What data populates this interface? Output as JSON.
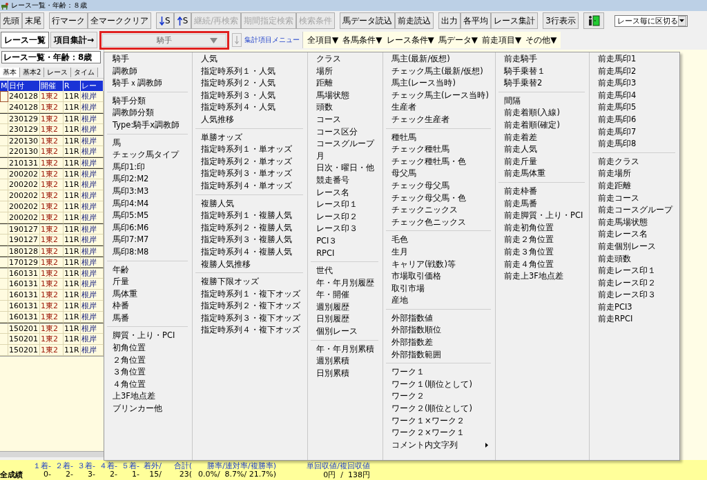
{
  "window": {
    "title": "レース一覧・年齢：８歳"
  },
  "toolbar": [
    [
      {
        "label": "先頭",
        "kind": "text",
        "disabled": false
      },
      {
        "label": "末尾",
        "kind": "text",
        "disabled": false
      }
    ],
    [
      {
        "label": "行マーク",
        "kind": "text",
        "disabled": false
      },
      {
        "label": "全マーククリア",
        "kind": "text",
        "disabled": false
      }
    ],
    [
      {
        "label": "S",
        "kind": "sort-down",
        "disabled": false
      },
      {
        "label": "S",
        "kind": "sort-up",
        "disabled": false
      },
      {
        "label": "継続/再検索",
        "kind": "text",
        "disabled": true
      },
      {
        "label": "期間指定検索",
        "kind": "text",
        "disabled": true
      },
      {
        "label": "検索条件",
        "kind": "text",
        "disabled": true
      }
    ],
    [
      {
        "label": "馬データ読込",
        "kind": "text",
        "disabled": false
      },
      {
        "label": "前走読込",
        "kind": "text",
        "disabled": false
      }
    ],
    [
      {
        "label": "出力",
        "kind": "text",
        "disabled": false
      },
      {
        "label": "各平均",
        "kind": "text",
        "disabled": false
      },
      {
        "label": "レース集計",
        "kind": "text",
        "disabled": false
      }
    ],
    [
      {
        "label": "3行表示",
        "kind": "text",
        "disabled": false
      }
    ],
    [
      {
        "kind": "exit-icon",
        "disabled": false
      }
    ]
  ],
  "split_select": {
    "value": "レース毎に区切る"
  },
  "mode_tabs": [
    {
      "label": "レース一覧",
      "selected": true
    },
    {
      "label": "項目集計→",
      "selected": false
    }
  ],
  "aggregate_select": {
    "value": "騎手",
    "highlighted": true
  },
  "aggregate_menu_link": "集計項目メニュー",
  "category_menus": [
    "全項目▼",
    "各馬条件▼",
    "レース条件▼",
    "馬データ▼",
    "前走項目▼",
    "その他▼"
  ],
  "panel_title": "レース一覧・年齢：8歳",
  "list_tabs": [
    {
      "label": "基本",
      "selected": true
    },
    {
      "label": "基本2",
      "selected": false
    },
    {
      "label": "レース",
      "selected": false
    },
    {
      "label": "タイム",
      "selected": false
    }
  ],
  "table": {
    "columns": [
      "M",
      "日付",
      "開催",
      "R",
      "レー"
    ],
    "rows": [
      [
        "",
        "240128",
        "1東2",
        "11R",
        "根岸"
      ],
      [
        "",
        "240128",
        "1東2",
        "11R",
        "根岸"
      ],
      [
        "",
        "230129",
        "1東2",
        "11R",
        "根岸"
      ],
      [
        "",
        "230129",
        "1東2",
        "11R",
        "根岸"
      ],
      [
        "",
        "220130",
        "1東2",
        "11R",
        "根岸"
      ],
      [
        "",
        "220130",
        "1東2",
        "11R",
        "根岸"
      ],
      [
        "",
        "210131",
        "1東2",
        "11R",
        "根岸"
      ],
      [
        "",
        "200202",
        "1東2",
        "11R",
        "根岸"
      ],
      [
        "",
        "200202",
        "1東2",
        "11R",
        "根岸"
      ],
      [
        "",
        "200202",
        "1東2",
        "11R",
        "根岸"
      ],
      [
        "",
        "200202",
        "1東2",
        "11R",
        "根岸"
      ],
      [
        "",
        "200202",
        "1東2",
        "11R",
        "根岸"
      ],
      [
        "",
        "190127",
        "1東2",
        "11R",
        "根岸"
      ],
      [
        "",
        "190127",
        "1東2",
        "11R",
        "根岸"
      ],
      [
        "",
        "180128",
        "1東2",
        "11R",
        "根岸"
      ],
      [
        "",
        "170129",
        "1東2",
        "11R",
        "根岸"
      ],
      [
        "",
        "160131",
        "1東2",
        "11R",
        "根岸"
      ],
      [
        "",
        "160131",
        "1東2",
        "11R",
        "根岸"
      ],
      [
        "",
        "160131",
        "1東2",
        "11R",
        "根岸"
      ],
      [
        "",
        "160131",
        "1東2",
        "11R",
        "根岸"
      ],
      [
        "",
        "160131",
        "1東2",
        "11R",
        "根岸"
      ],
      [
        "",
        "150201",
        "1東2",
        "11R",
        "根岸"
      ],
      [
        "",
        "150201",
        "1東2",
        "11R",
        "根岸"
      ],
      [
        "",
        "150201",
        "1東2",
        "11R",
        "根岸"
      ]
    ]
  },
  "dropdown_menu": {
    "columns": [
      [
        [
          "騎手",
          "調教師",
          "騎手ｘ調教師"
        ],
        [
          "騎手分類",
          "調教師分類",
          "Type:騎手x調教師"
        ],
        [
          "馬",
          "チェック馬タイプ",
          "馬印1:印",
          "馬印2:M2",
          "馬印3:M3",
          "馬印4:M4",
          "馬印5:M5",
          "馬印6:M6",
          "馬印7:M7",
          "馬印8:M8"
        ],
        [
          "年齢",
          "斤量",
          "馬体重",
          "枠番",
          "馬番"
        ],
        [
          "脚質・上り・PCI",
          "初角位置",
          "２角位置",
          "３角位置",
          "４角位置",
          "上3F地点差",
          "ブリンカー他"
        ]
      ],
      [
        [
          "人気",
          "指定時系列１・人気",
          "指定時系列２・人気",
          "指定時系列３・人気",
          "指定時系列４・人気",
          "人気推移"
        ],
        [
          "単勝オッズ",
          "指定時系列１・単オッズ",
          "指定時系列２・単オッズ",
          "指定時系列３・単オッズ",
          "指定時系列４・単オッズ"
        ],
        [
          "複勝人気",
          "指定時系列１・複勝人気",
          "指定時系列２・複勝人気",
          "指定時系列３・複勝人気",
          "指定時系列４・複勝人気",
          "複勝人気推移"
        ],
        [
          "複勝下限オッズ",
          "指定時系列１・複下オッズ",
          "指定時系列２・複下オッズ",
          "指定時系列３・複下オッズ",
          "指定時系列４・複下オッズ"
        ]
      ],
      [
        [
          "クラス",
          "場所",
          "距離",
          "馬場状態",
          "頭数",
          "コース",
          "コース区分",
          "コースグループ",
          "月",
          "日次・曜日・他",
          "競走番号",
          "レース名",
          "レース印１",
          "レース印２",
          "レース印３",
          "PCI３",
          "RPCI"
        ],
        [
          "世代",
          "年・年月別履歴",
          "年・開催",
          "週別履歴",
          "日別履歴",
          "個別レース"
        ],
        [
          "年・年月別累積",
          "週別累積",
          "日別累積"
        ]
      ],
      [
        [
          "馬主(最新/仮想)",
          "チェック馬主(最新/仮想)",
          "馬主(レース当時)",
          "チェック馬主(レース当時)",
          "生産者",
          "チェック生産者"
        ],
        [
          "種牡馬",
          "チェック種牡馬",
          "チェック種牡馬・色",
          "母父馬",
          "チェック母父馬",
          "チェック母父馬・色",
          "チェックニックス",
          "チェック色ニックス"
        ],
        [
          "毛色",
          "生月",
          "キャリア(戦数)等",
          "市場取引価格",
          "取引市場",
          "産地"
        ],
        [
          "外部指数値",
          "外部指数順位",
          "外部指数差",
          "外部指数範囲"
        ],
        [
          "ワーク１",
          "ワーク１(順位として)",
          "ワーク２",
          "ワーク２(順位として)",
          "ワーク１×ワーク２",
          "ワーク２×ワーク１",
          {
            "label": "コメント内文字列",
            "kind": "submenu"
          }
        ]
      ],
      [
        [
          "前走騎手",
          "騎手乗替１",
          "騎手乗替2"
        ],
        [
          "間隔",
          "前走着順(入線)",
          "前走着順(確定)",
          "前走着差",
          "前走人気",
          "前走斤量",
          "前走馬体重"
        ],
        [
          "前走枠番",
          "前走馬番",
          "前走脚質・上り・PCI",
          "前走初角位置",
          "前走２角位置",
          "前走３角位置",
          "前走４角位置",
          "前走上3F地点差"
        ]
      ],
      [
        [
          "前走馬印1",
          "前走馬印2",
          "前走馬印3",
          "前走馬印4",
          "前走馬印5",
          "前走馬印6",
          "前走馬印7",
          "前走馬印8"
        ],
        [
          "前走クラス",
          "前走場所",
          "前走距離",
          "前走コース",
          "前走コースグループ",
          "前走馬場状態",
          "前走レース名",
          "前走個別レース",
          "前走頭数",
          "前走レース印１",
          "前走レース印２",
          "前走レース印３",
          "前走PCI3",
          "前走RPCI"
        ]
      ]
    ]
  },
  "summary": {
    "label": "全成績",
    "headers": [
      "１着-",
      "２着-",
      "３着-",
      "４着-",
      "５着-",
      "着外/",
      "合計(",
      "勝率/連対率/複勝率)",
      "単回収値/複回収値"
    ],
    "values": [
      "0-",
      "2-",
      "3-",
      "2-",
      "1-",
      "15/",
      "23(",
      "0.0%/  8.7%/ 21.7%)",
      "0円  /  138円"
    ]
  }
}
